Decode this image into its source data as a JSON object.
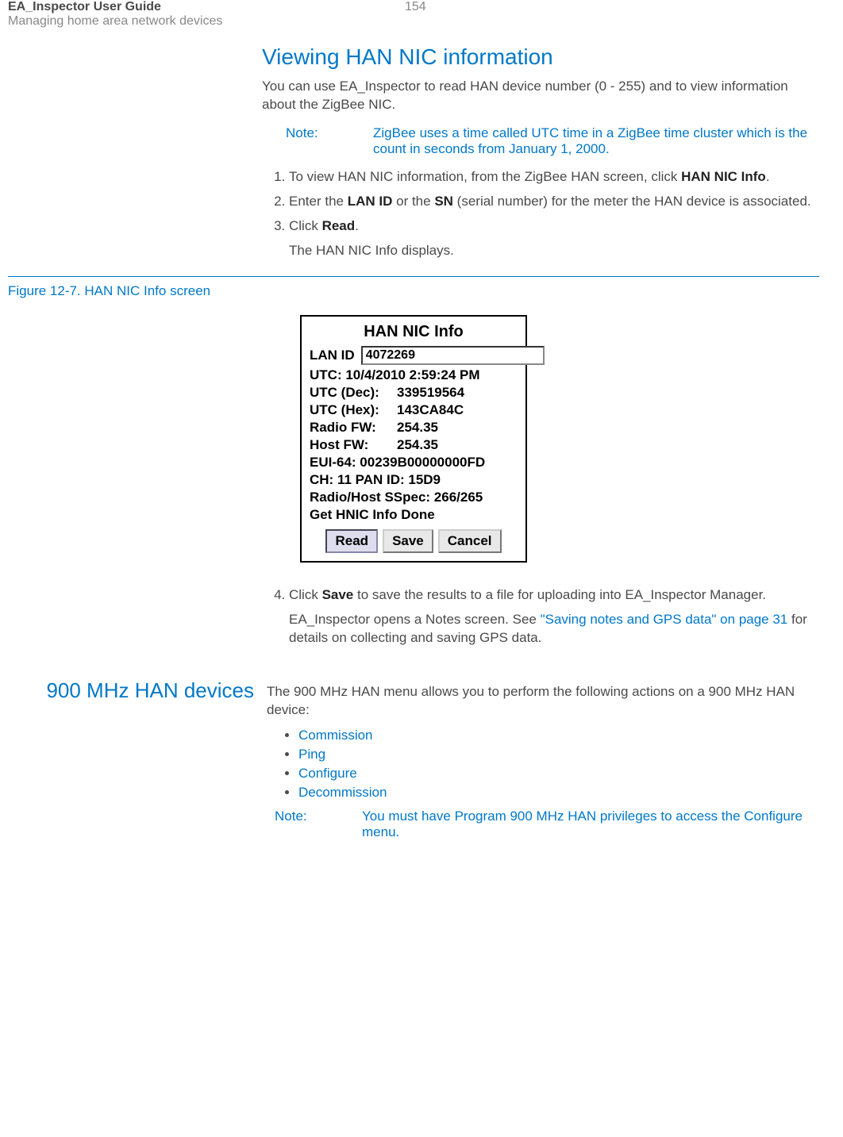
{
  "header": {
    "doc_title": "EA_Inspector User Guide",
    "doc_subtitle": "Managing home area network devices",
    "page_number": "154"
  },
  "section1": {
    "heading": "Viewing HAN NIC information",
    "intro": "You can use EA_Inspector to read HAN device number (0 - 255) and to view information about the ZigBee NIC.",
    "note_label": "Note:",
    "note_text": "ZigBee uses a time called UTC time in a ZigBee time cluster which is the count in seconds from January 1, 2000.",
    "step1_a": "To view HAN NIC information, from the ZigBee HAN screen, click ",
    "step1_b": "HAN NIC Info",
    "step1_c": ".",
    "step2_a": "Enter the ",
    "step2_b": "LAN ID",
    "step2_c": " or the ",
    "step2_d": "SN",
    "step2_e": " (serial number) for the meter the HAN device is associated.",
    "step3_a": "Click ",
    "step3_b": "Read",
    "step3_c": ".",
    "step3_sub": "The HAN NIC Info displays."
  },
  "figure": {
    "caption": "Figure 12-7. HAN NIC Info screen",
    "title": "HAN NIC Info",
    "lan_id_label": "LAN ID",
    "lan_id_value": "4072269",
    "utc_line": "UTC:  10/4/2010 2:59:24 PM",
    "utc_dec_label": "UTC (Dec):",
    "utc_dec_value": "339519564",
    "utc_hex_label": "UTC (Hex):",
    "utc_hex_value": "143CA84C",
    "radio_fw_label": "Radio FW:",
    "radio_fw_value": "254.35",
    "host_fw_label": "Host FW:",
    "host_fw_value": "254.35",
    "eui_line": "EUI-64:  00239B00000000FD",
    "ch_pan_line": "CH:   11     PAN ID:  15D9",
    "sspec_line": "Radio/Host SSpec:  266/265",
    "status_line": "Get HNIC Info Done",
    "btn_read": "Read",
    "btn_save": "Save",
    "btn_cancel": "Cancel"
  },
  "after_figure": {
    "step4_a": "Click ",
    "step4_b": "Save",
    "step4_c": " to save the results to a file for uploading into EA_Inspector Manager.",
    "step4_sub_a": "EA_Inspector opens a Notes screen. See ",
    "step4_sub_link": "\"Saving notes and GPS data\" on page 31",
    "step4_sub_b": " for details on collecting and saving GPS data."
  },
  "section2": {
    "heading": "900 MHz HAN devices",
    "intro": "The 900 MHz HAN menu allows you to perform the following actions on a 900 MHz HAN device:",
    "bullets": {
      "b1": "Commission",
      "b2": "Ping",
      "b3": "Configure",
      "b4": "Decommission"
    },
    "note_label": "Note:",
    "note_a": "You must have ",
    "note_b": "Program 900 MHz HAN privileges to access the Configure menu."
  }
}
